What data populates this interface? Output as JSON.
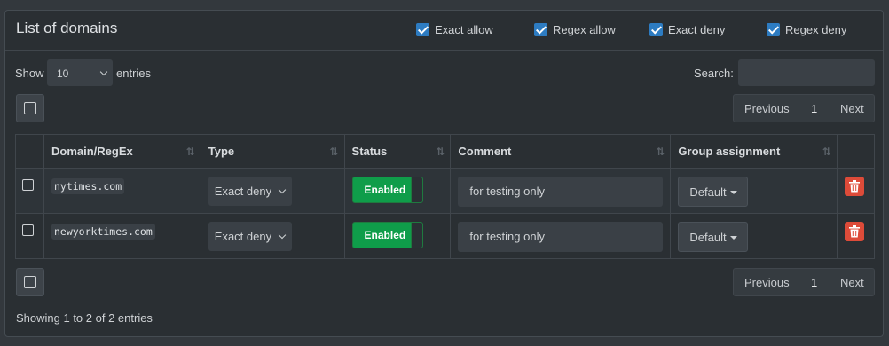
{
  "title": "List of domains",
  "filters": [
    {
      "label": "Exact allow",
      "checked": true
    },
    {
      "label": "Regex allow",
      "checked": true
    },
    {
      "label": "Exact deny",
      "checked": true
    },
    {
      "label": "Regex deny",
      "checked": true
    }
  ],
  "length": {
    "show_label": "Show",
    "value": "10",
    "entries_label": "entries"
  },
  "search": {
    "label": "Search:",
    "placeholder": ""
  },
  "pagination": {
    "previous": "Previous",
    "page": "1",
    "next": "Next"
  },
  "table": {
    "columns": [
      "Domain/RegEx",
      "Type",
      "Status",
      "Comment",
      "Group assignment"
    ],
    "rows": [
      {
        "domain": "nytimes.com",
        "type": "Exact deny",
        "status": "Enabled",
        "comment": "for testing only",
        "group": "Default"
      },
      {
        "domain": "newyorktimes.com",
        "type": "Exact deny",
        "status": "Enabled",
        "comment": "for testing only",
        "group": "Default"
      }
    ]
  },
  "info": "Showing 1 to 2 of 2 entries",
  "colors": {
    "checkbox_accent": "#2d7cc2",
    "toggle_enabled": "#0f9d4a",
    "delete_button": "#dd4b39"
  },
  "icons": {
    "sort": "sort-icon",
    "delete": "trash-icon",
    "dropdown": "caret-down-icon"
  }
}
